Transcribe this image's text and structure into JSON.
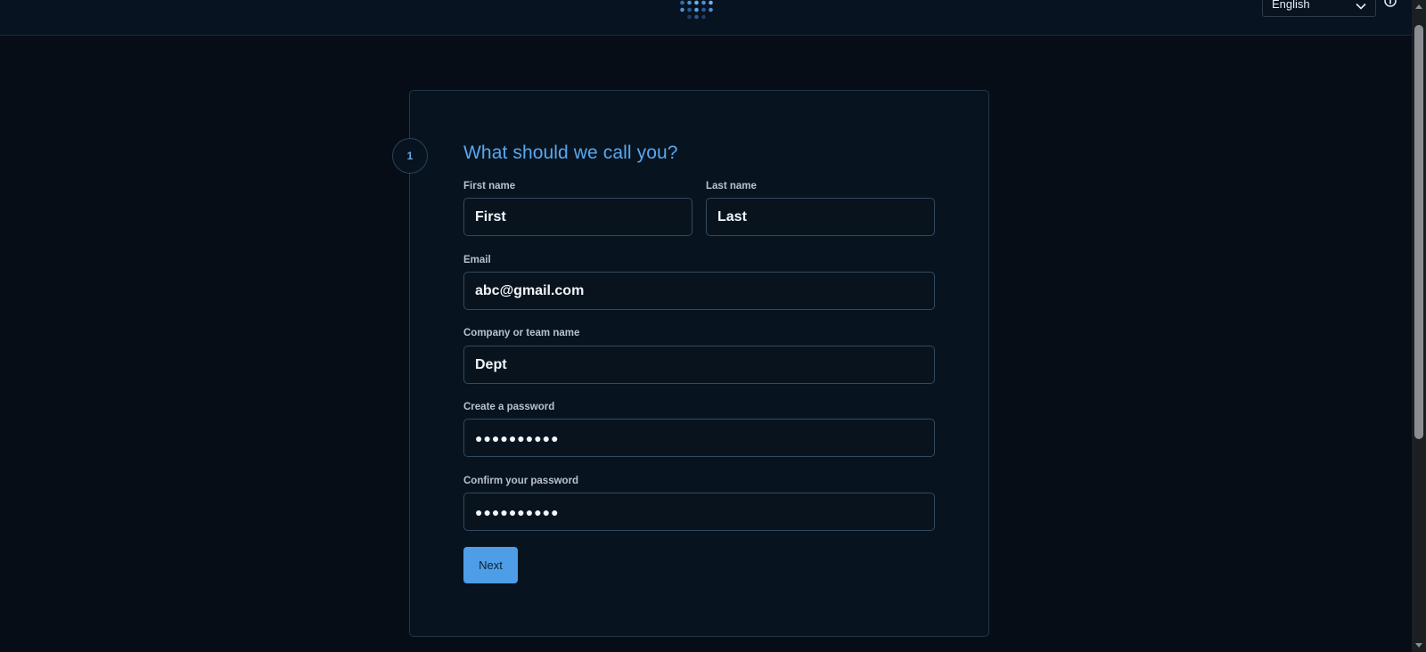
{
  "header": {
    "language": {
      "selected": "English"
    }
  },
  "form": {
    "step_number": "1",
    "title": "What should we call you?",
    "first_name": {
      "label": "First name",
      "value": "First"
    },
    "last_name": {
      "label": "Last name",
      "value": "Last"
    },
    "email": {
      "label": "Email",
      "value": "abc@gmail.com"
    },
    "company": {
      "label": "Company or team name",
      "value": "Dept"
    },
    "password": {
      "label": "Create a password",
      "masked_value": "●●●●●●●●●●"
    },
    "confirm_password": {
      "label": "Confirm your password",
      "masked_value": "●●●●●●●●●●"
    },
    "next_label": "Next"
  },
  "icons": {
    "logo": "dot-grid-logo-icon",
    "chevron": "chevron-down-icon",
    "info": "info-icon"
  },
  "colors": {
    "accent": "#4d9ee6",
    "title": "#5aa7ee",
    "background": "#060d17",
    "card": "#071420"
  }
}
